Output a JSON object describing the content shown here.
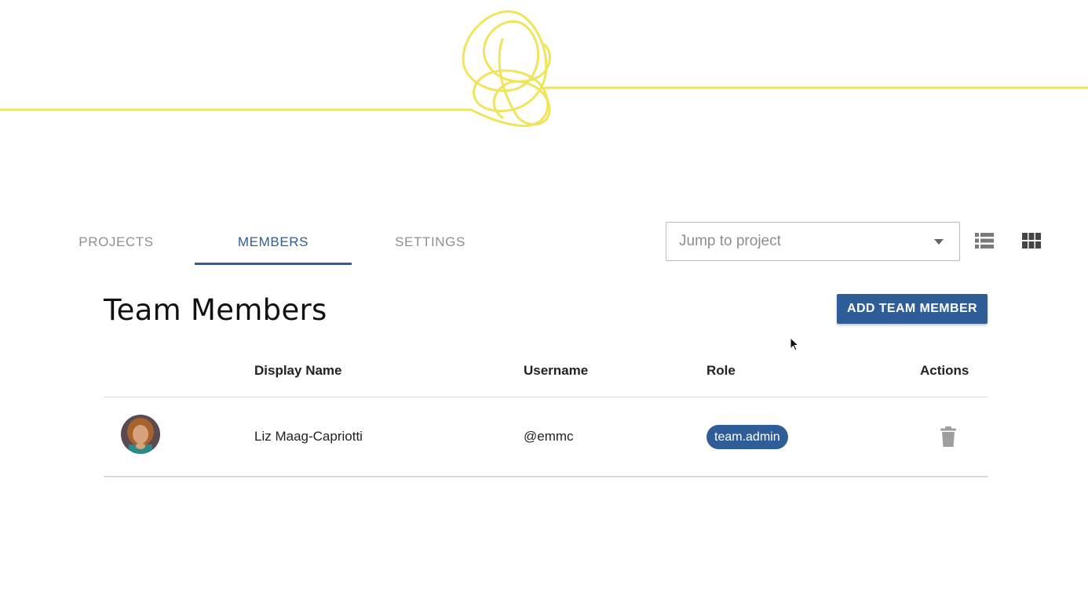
{
  "tabs": [
    {
      "label": "PROJECTS",
      "active": false
    },
    {
      "label": "MEMBERS",
      "active": true
    },
    {
      "label": "SETTINGS",
      "active": false
    }
  ],
  "jump": {
    "placeholder": "Jump to project"
  },
  "view_toggle": {
    "list_icon": "list-view-icon",
    "grid_icon": "grid-view-icon"
  },
  "page": {
    "title": "Team Members",
    "add_button": "ADD TEAM MEMBER"
  },
  "table": {
    "columns": [
      "",
      "Display Name",
      "Username",
      "Role",
      "Actions"
    ],
    "rows": [
      {
        "display_name": "Liz Maag-Capriotti",
        "username": "@emmc",
        "role": "team.admin",
        "action_icon": "trash-icon"
      }
    ]
  },
  "colors": {
    "accent": "#2f5d98",
    "banner_line": "#f0e55a"
  }
}
